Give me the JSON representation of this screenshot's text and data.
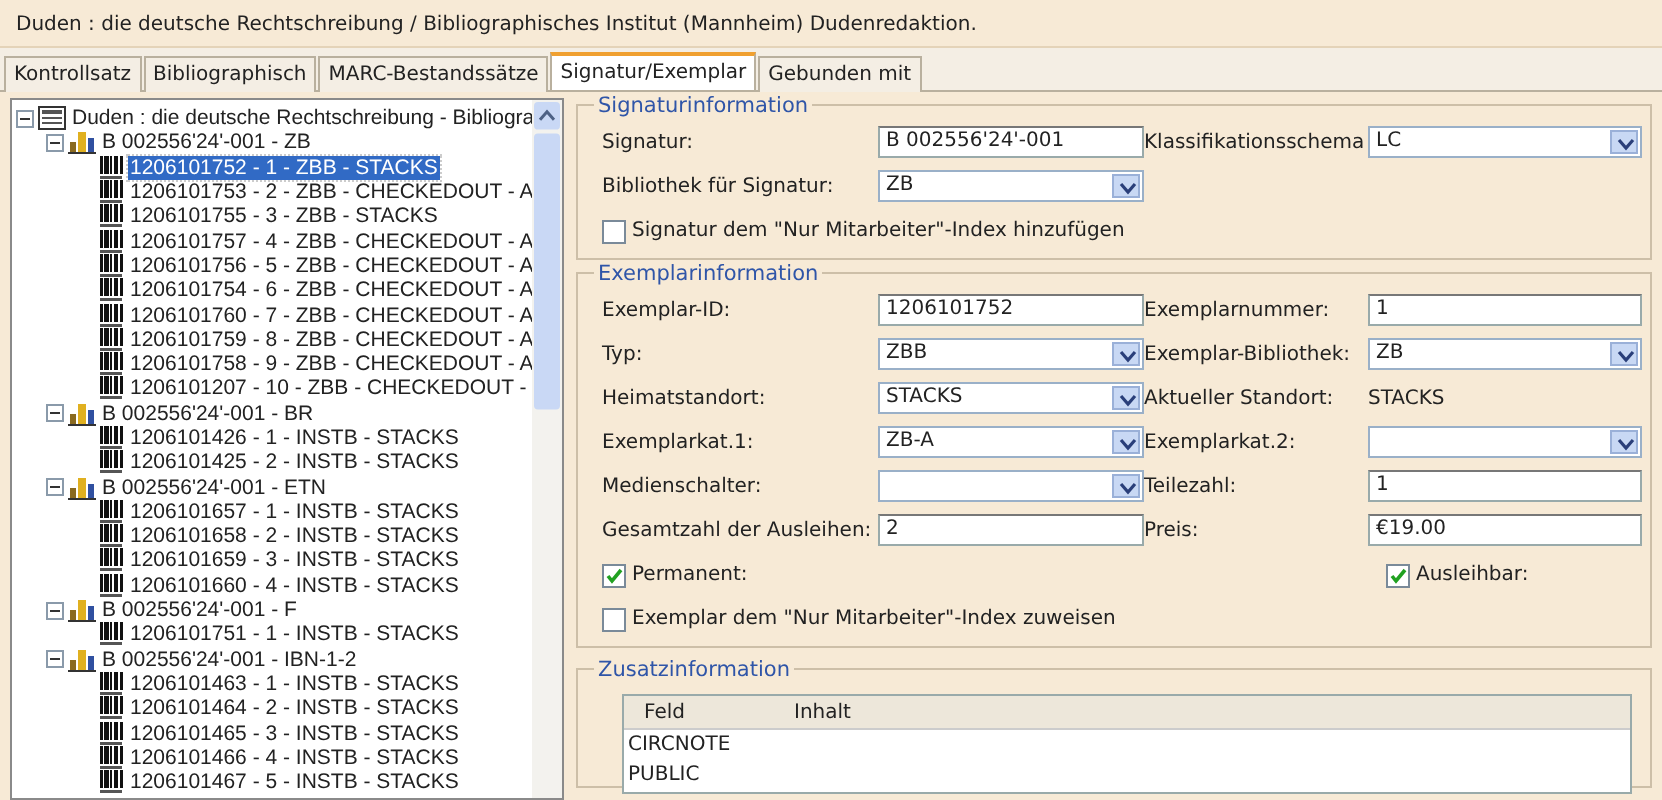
{
  "window": {
    "title": "Duden : die deutsche Rechtschreibung / Bibliographisches Institut (Mannheim) Dudenredaktion."
  },
  "tabs": [
    {
      "label": "Kontrollsatz",
      "selected": false
    },
    {
      "label": "Bibliographisch",
      "selected": false
    },
    {
      "label": "MARC-Bestandssätze",
      "selected": false
    },
    {
      "label": "Signatur/Exemplar",
      "selected": true
    },
    {
      "label": "Gebunden mit",
      "selected": false
    }
  ],
  "tree": [
    {
      "label": "Duden : die deutsche Rechtschreibung - Bibliogra",
      "kind": "record",
      "expanded": true,
      "selected": false,
      "children": [
        {
          "label": "B 002556'24'-001 - ZB",
          "kind": "holding",
          "expanded": true,
          "selected": false,
          "children": [
            {
              "label": "1206101752 - 1 - ZBB - STACKS",
              "kind": "item",
              "selected": true
            },
            {
              "label": "1206101753 - 2 - ZBB - CHECKEDOUT - A",
              "kind": "item",
              "selected": false
            },
            {
              "label": "1206101755 - 3 - ZBB - STACKS",
              "kind": "item",
              "selected": false
            },
            {
              "label": "1206101757 - 4 - ZBB - CHECKEDOUT - A",
              "kind": "item",
              "selected": false
            },
            {
              "label": "1206101756 - 5 - ZBB - CHECKEDOUT - A",
              "kind": "item",
              "selected": false
            },
            {
              "label": "1206101754 - 6 - ZBB - CHECKEDOUT - A",
              "kind": "item",
              "selected": false
            },
            {
              "label": "1206101760 - 7 - ZBB - CHECKEDOUT - A",
              "kind": "item",
              "selected": false
            },
            {
              "label": "1206101759 - 8 - ZBB - CHECKEDOUT - A",
              "kind": "item",
              "selected": false
            },
            {
              "label": "1206101758 - 9 - ZBB - CHECKEDOUT - A",
              "kind": "item",
              "selected": false
            },
            {
              "label": "1206101207 - 10 - ZBB - CHECKEDOUT -",
              "kind": "item",
              "selected": false
            }
          ]
        },
        {
          "label": "B 002556'24'-001 - BR",
          "kind": "holding",
          "expanded": true,
          "selected": false,
          "children": [
            {
              "label": "1206101426 - 1 - INSTB - STACKS",
              "kind": "item",
              "selected": false
            },
            {
              "label": "1206101425 - 2 - INSTB - STACKS",
              "kind": "item",
              "selected": false
            }
          ]
        },
        {
          "label": "B 002556'24'-001 - ETN",
          "kind": "holding",
          "expanded": true,
          "selected": false,
          "children": [
            {
              "label": "1206101657 - 1 - INSTB - STACKS",
              "kind": "item",
              "selected": false
            },
            {
              "label": "1206101658 - 2 - INSTB - STACKS",
              "kind": "item",
              "selected": false
            },
            {
              "label": "1206101659 - 3 - INSTB - STACKS",
              "kind": "item",
              "selected": false
            },
            {
              "label": "1206101660 - 4 - INSTB - STACKS",
              "kind": "item",
              "selected": false
            }
          ]
        },
        {
          "label": "B 002556'24'-001 - F",
          "kind": "holding",
          "expanded": true,
          "selected": false,
          "children": [
            {
              "label": "1206101751 - 1 - INSTB - STACKS",
              "kind": "item",
              "selected": false
            }
          ]
        },
        {
          "label": "B 002556'24'-001 - IBN-1-2",
          "kind": "holding",
          "expanded": true,
          "selected": false,
          "children": [
            {
              "label": "1206101463 - 1 - INSTB - STACKS",
              "kind": "item",
              "selected": false
            },
            {
              "label": "1206101464 - 2 - INSTB - STACKS",
              "kind": "item",
              "selected": false
            },
            {
              "label": "1206101465 - 3 - INSTB - STACKS",
              "kind": "item",
              "selected": false
            },
            {
              "label": "1206101466 - 4 - INSTB - STACKS",
              "kind": "item",
              "selected": false
            },
            {
              "label": "1206101467 - 5 - INSTB - STACKS",
              "kind": "item",
              "selected": false
            }
          ]
        }
      ]
    }
  ],
  "sections": [
    {
      "title": "Signaturinformation",
      "fields": [
        {
          "label": "Signatur:",
          "kind": "input",
          "value": "B 002556'24'-001"
        },
        {
          "label": "Klassifikationsschema",
          "kind": "select",
          "value": "LC"
        },
        {
          "label": "Bibliothek für Signatur:",
          "kind": "select",
          "value": "ZB"
        }
      ],
      "checkbox_rows": [
        [
          {
            "label": "Signatur dem \"Nur Mitarbeiter\"-Index hinzufügen",
            "checked": false
          }
        ]
      ]
    },
    {
      "title": "Exemplarinformation",
      "fields": [
        {
          "label": "Exemplar-ID:",
          "kind": "input",
          "value": "1206101752"
        },
        {
          "label": "Exemplarnummer:",
          "kind": "input",
          "value": "1"
        },
        {
          "label": "Typ:",
          "kind": "select",
          "value": "ZBB"
        },
        {
          "label": "Exemplar-Bibliothek:",
          "kind": "select",
          "value": "ZB"
        },
        {
          "label": "Heimatstandort:",
          "kind": "select",
          "value": "STACKS"
        },
        {
          "label": "Aktueller Standort:",
          "kind": "text",
          "value": "STACKS"
        },
        {
          "label": "Exemplarkat.1:",
          "kind": "select",
          "value": "ZB-A"
        },
        {
          "label": "Exemplarkat.2:",
          "kind": "select"
        },
        {
          "label": "Medienschalter:",
          "kind": "select"
        },
        {
          "label": "Teilezahl:",
          "kind": "input",
          "value": "1"
        },
        {
          "label": "Gesamtzahl der Ausleihen:",
          "kind": "input",
          "value": "2"
        },
        {
          "label": "Preis:",
          "kind": "input",
          "value": "€19.00"
        }
      ],
      "checkbox_rows": [
        [
          {
            "label": "Permanent:",
            "checked": true
          },
          {
            "label": "Ausleihbar:",
            "checked": true
          }
        ],
        [
          {
            "label": "Exemplar dem \"Nur Mitarbeiter\"-Index zuweisen",
            "checked": false
          }
        ]
      ]
    }
  ],
  "extra": {
    "title": "Zusatzinformation",
    "columns": [
      "Feld",
      "Inhalt"
    ],
    "rows": [
      [
        "CIRCNOTE"
      ],
      [
        "PUBLIC"
      ]
    ]
  }
}
